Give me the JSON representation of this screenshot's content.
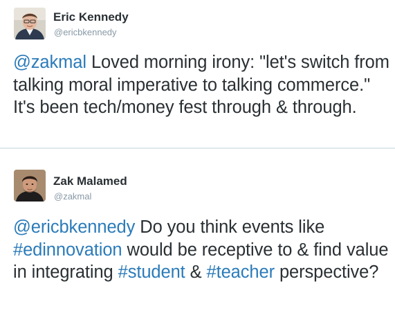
{
  "tweets": [
    {
      "author": {
        "name": "Eric Kennedy",
        "handle": "@ericbkennedy"
      },
      "mention": "@zakmal",
      "text_1": " Loved morning irony: \"let's switch from talking moral imperative to talking commerce.\" It's been tech/money fest through & through."
    },
    {
      "author": {
        "name": "Zak Malamed",
        "handle": "@zakmal"
      },
      "mention": "@ericbkennedy",
      "text_1": " Do you think events like ",
      "hashtag_1": "#edinnovation",
      "text_2": " would be receptive to & find value in integrating ",
      "hashtag_2": "#student",
      "text_3": " & ",
      "hashtag_3": "#teacher",
      "text_4": " perspective?"
    }
  ],
  "colors": {
    "link": "#2b7bb9",
    "text": "#292f33",
    "handle": "#8899a6",
    "divider": "#e1e8ed"
  },
  "icons": {
    "avatar_1": "avatar-eric-kennedy",
    "avatar_2": "avatar-zak-malamed"
  }
}
